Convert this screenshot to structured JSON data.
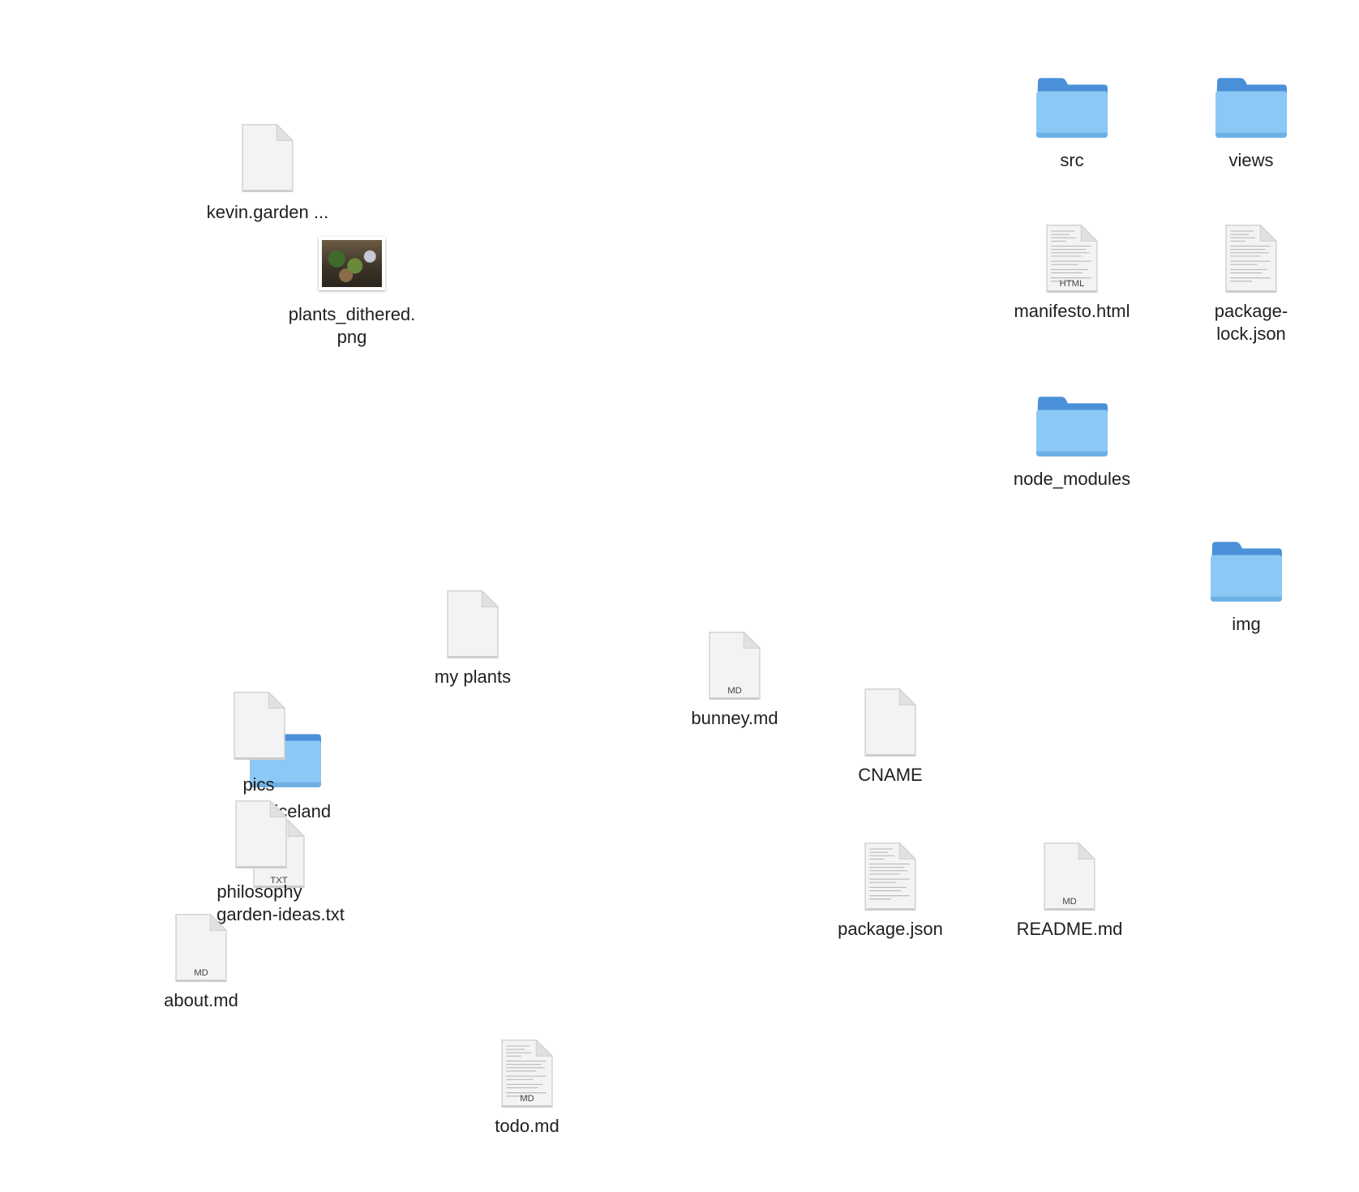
{
  "desktop": {
    "items": [
      {
        "name": "kevin-garden-file",
        "kind": "file",
        "label": "kevin.garden ..."
      },
      {
        "name": "plants-dithered-png",
        "kind": "image",
        "label": "plants_dithered.\npng"
      },
      {
        "name": "src-folder",
        "kind": "folder",
        "label": "src"
      },
      {
        "name": "views-folder",
        "kind": "folder",
        "label": "views"
      },
      {
        "name": "manifesto-html",
        "kind": "file",
        "badge": "HTML",
        "label": "manifesto.html"
      },
      {
        "name": "package-lock-json",
        "kind": "file",
        "label": "package-\nlock.json"
      },
      {
        "name": "node-modules-folder",
        "kind": "folder",
        "label": "node_modules"
      },
      {
        "name": "img-folder",
        "kind": "folder",
        "label": "img"
      },
      {
        "name": "my-plants-file",
        "kind": "file",
        "label": "my plants"
      },
      {
        "name": "bunney-md",
        "kind": "file",
        "badge": "MD",
        "label": "bunney.md"
      },
      {
        "name": "cname-file",
        "kind": "file",
        "label": "CNAME"
      },
      {
        "name": "package-json",
        "kind": "file",
        "label": "package.json"
      },
      {
        "name": "readme-md",
        "kind": "file",
        "badge": "MD",
        "label": "README.md"
      },
      {
        "name": "pics-file",
        "kind": "file",
        "label": "pics"
      },
      {
        "name": "iceland-folder",
        "kind": "folder",
        "label": "2   iceland"
      },
      {
        "name": "philosophy-file",
        "kind": "file",
        "label": "philosophy"
      },
      {
        "name": "garden-ideas-txt",
        "kind": "file",
        "badge": "TXT",
        "label": "garden-ideas.txt"
      },
      {
        "name": "about-md",
        "kind": "file",
        "badge": "MD",
        "label": "about.md"
      },
      {
        "name": "todo-md",
        "kind": "file",
        "badge": "MD",
        "label": "todo.md"
      }
    ]
  },
  "colors": {
    "folder_back": "#4a90d9",
    "folder_front": "#8cc8f5",
    "page": "#f2f2f2",
    "label": "#1f1f1f"
  }
}
